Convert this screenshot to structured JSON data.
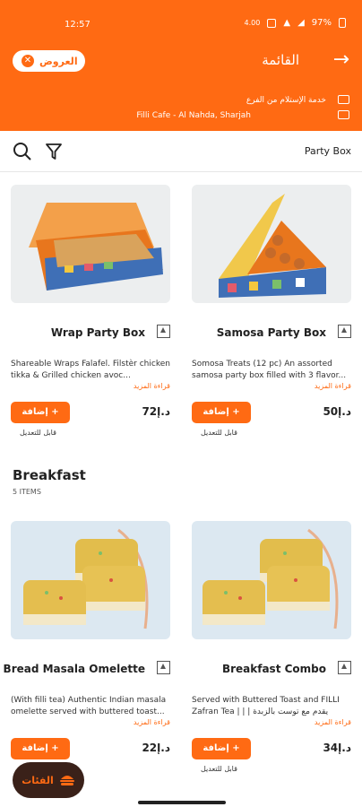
{
  "status_bar": {
    "time": "12:57",
    "net": "4.00",
    "battery": "97%"
  },
  "header": {
    "offers_label": "العروض",
    "title": "القائمة",
    "back_icon": "arrow-right-icon"
  },
  "branch": {
    "service": "خدمة الإستلام من الفرع",
    "location": "Filli Cafe - Al Nahda, Sharjah"
  },
  "toolbar": {
    "category": "Party Box"
  },
  "sections": [
    {
      "items": [
        {
          "name": "Wrap Party Box",
          "description": "Shareable Wraps Falafel. Filstèr chicken tikka & Grilled chicken avoc...",
          "more": "قراءة المزيد",
          "add_label": "إضافة +",
          "price": "72د.إ",
          "customizable": "قابل للتعديل"
        },
        {
          "name": "Samosa Party Box",
          "description": "Somosa Treats (12 pc) An assorted samosa party box filled with 3 flavor...",
          "more": "قراءة المزيد",
          "add_label": "إضافة +",
          "price": "50د.إ",
          "customizable": "قابل للتعديل"
        }
      ]
    },
    {
      "title": "Breakfast",
      "count": "5 ITEMS",
      "items": [
        {
          "name": "Bread Masala Omelette",
          "description": "(With filli tea) Authentic Indian masala omelette served with buttered toast...",
          "more": "قراءة المزيد",
          "add_label": "إضافة +",
          "price": "22د.إ"
        },
        {
          "name": "Breakfast Combo",
          "description": "Served with Buttered Toast and FILLI Zafran Tea | | | يقدم مع توست بالزبدة وشا...",
          "more": "قراءة المزيد",
          "add_label": "إضافة +",
          "price": "34د.إ",
          "customizable": "قابل للتعديل"
        }
      ]
    }
  ],
  "floating_button": {
    "label": "الفئات",
    "icon": "burger-icon"
  },
  "colors": {
    "accent": "#FF6A13"
  }
}
